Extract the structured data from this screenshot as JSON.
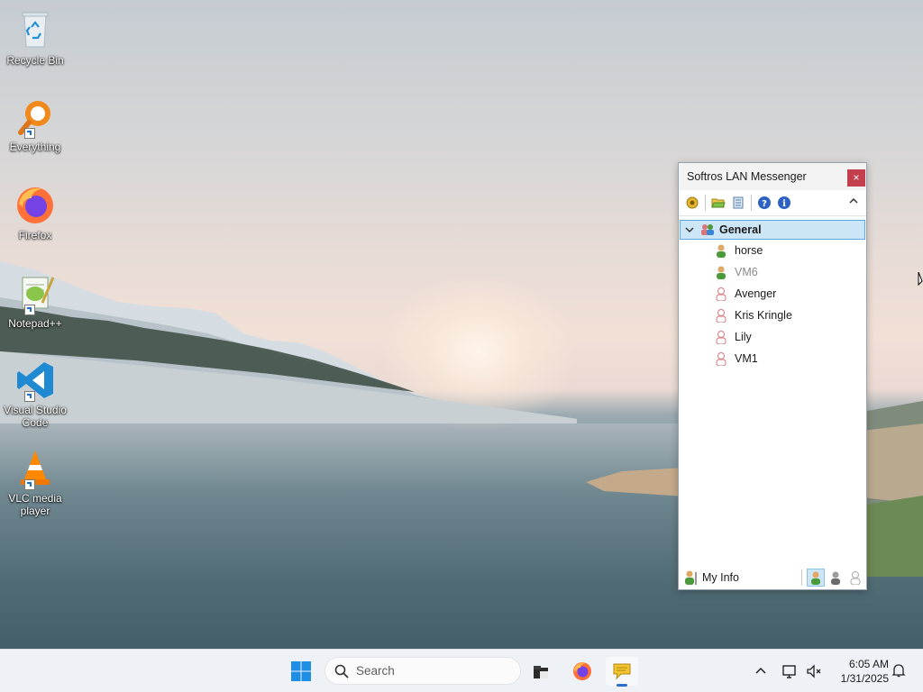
{
  "desktop": {
    "icons": [
      {
        "label": "Recycle Bin",
        "icon": "recycle-bin-icon"
      },
      {
        "label": "Everything",
        "icon": "everything-search-icon"
      },
      {
        "label": "Firefox",
        "icon": "firefox-icon"
      },
      {
        "label": "Notepad++",
        "icon": "notepad-plus-plus-icon"
      },
      {
        "label": "Visual Studio Code",
        "icon": "vscode-icon"
      },
      {
        "label": "VLC media player",
        "icon": "vlc-icon"
      }
    ]
  },
  "messenger": {
    "title": "Softros LAN Messenger",
    "close_label": "×",
    "group": {
      "name": "General"
    },
    "users": [
      {
        "name": "horse",
        "status": "online"
      },
      {
        "name": "VM6",
        "status": "offline"
      },
      {
        "name": "Avenger",
        "status": "busy"
      },
      {
        "name": "Kris Kringle",
        "status": "busy"
      },
      {
        "name": "Lily",
        "status": "busy"
      },
      {
        "name": "VM1",
        "status": "busy"
      }
    ],
    "my_info_label": "My Info",
    "colors": {
      "online": "#4a9a3a",
      "busy": "#d9767a",
      "offline_text": "#8a8a8a",
      "selection": "#cce6f8"
    }
  },
  "taskbar": {
    "search_placeholder": "Search",
    "apps": [
      "file-explorer-icon",
      "firefox-icon",
      "softros-messenger-icon"
    ],
    "time": "6:05 AM",
    "date": "1/31/2025"
  }
}
